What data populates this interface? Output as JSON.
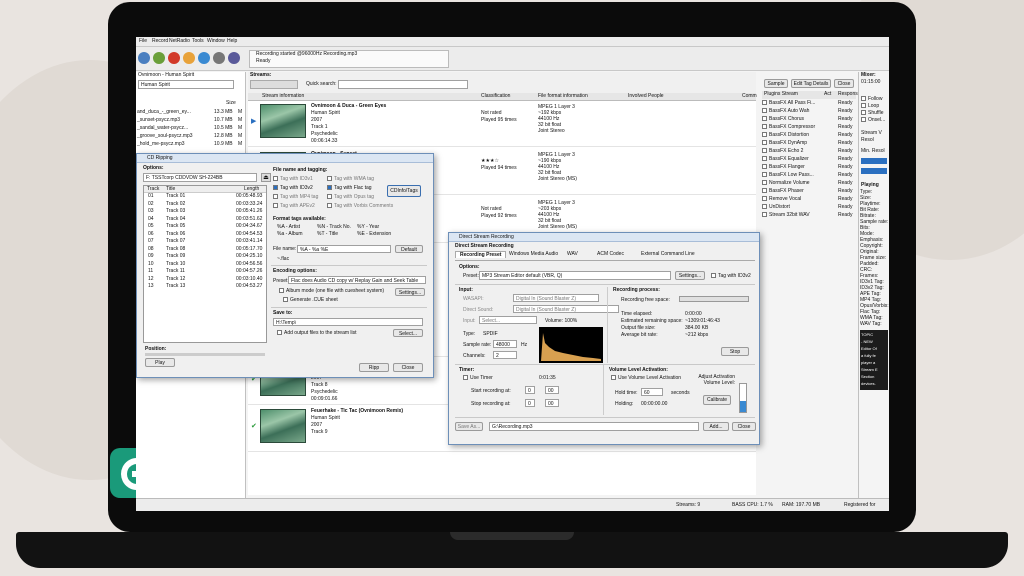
{
  "app": {
    "menu": [
      "File",
      "Record",
      "NetRadio",
      "Tools",
      "Window",
      "Help"
    ],
    "status": [
      "Recording started @96000Hz Recording.mp3",
      "Ready"
    ],
    "statusbar": {
      "streams": "Streams: 9",
      "cpu": "BASS CPU: 1.7 %",
      "ram": "RAM: 197.70 MB",
      "reg": "Registered for"
    }
  },
  "left": {
    "folder": "Ovnimoon - Human Spirit",
    "artist": "Human Spirit",
    "size_hdr": "Size",
    "files": [
      {
        "name": "and_duca_-_green_ey...",
        "size": "13.3 MB",
        "t": "M"
      },
      {
        "name": "_sunset-psycz.mp3",
        "size": "10.7 MB",
        "t": "M"
      },
      {
        "name": "_sandal_water-psycz...",
        "size": "10.5 MB",
        "t": "M"
      },
      {
        "name": "_groove_soul-psycz.mp3",
        "size": "12.8 MB",
        "t": "M"
      },
      {
        "name": "_hold_me-psycz.mp3",
        "size": "10.9 MB",
        "t": "M"
      }
    ]
  },
  "streams": {
    "label": "Streams:",
    "quick": "Quick search:",
    "cols": [
      "Stream information",
      "Classification",
      "File format information",
      "Involved People",
      "Comm"
    ],
    "items": [
      {
        "title": "Ovnimoon & Duca - Green Eyes",
        "lines": [
          "Human Spirit",
          "2007",
          "Track 1",
          "Psychedelic",
          "00:06:14.33"
        ],
        "cls": [
          "Not rated",
          "Played 95 times"
        ],
        "fmt": [
          "MPEG 1 Layer 3",
          "~192 kbps",
          "44100 Hz",
          "32 bit float",
          "Joint Stereo"
        ]
      },
      {
        "title": "Ovnimoon - Sunset",
        "lines": [],
        "cls": [
          "★★★☆",
          "Played 94 times"
        ],
        "fmt": [
          "MPEG 1 Layer 3",
          "~190 kbps",
          "44100 Hz",
          "32 bit float",
          "Joint Stereo (MS)"
        ]
      },
      {
        "title": "",
        "lines": [],
        "cls": [
          "Not rated",
          "Played 92 times"
        ],
        "fmt": [
          "MPEG 1 Layer 3",
          "~203 kbps",
          "44100 Hz",
          "32 bit float",
          "Joint Stereo (MS)"
        ]
      },
      {
        "title": "",
        "lines": [
          "Human Spirit",
          "2007",
          "Track 7",
          "Psychedelic",
          "00:08:01.18"
        ],
        "cls": [],
        "fmt": []
      },
      {
        "title": "Ovnimoon - Turn Off The light",
        "lines": [
          "Human Spirit",
          "2007",
          "Track 8",
          "Psychedelic",
          "00:09:01.66"
        ],
        "cls": [],
        "fmt": []
      },
      {
        "title": "Feuerhake - Tic Tac (Ovnimoon Remix)",
        "lines": [
          "Human Spirit",
          "2007",
          "Track 9"
        ],
        "cls": [
          "Not rated",
          "Played 90 times"
        ],
        "fmt": [
          "MPEG 1 Layer 3",
          "~200 kbps",
          "44100 Hz"
        ]
      }
    ]
  },
  "right": {
    "buttons": [
      "Sample",
      "Edit Tag Details",
      "Close"
    ],
    "plugin_hdr": [
      "Plugins Stream",
      "Act",
      "Response"
    ],
    "plugins": [
      "BassFX All Pass Fi...",
      "BassFX Auto Wah",
      "BassFX Chorus",
      "BassFX Compressor",
      "BassFX Distortion",
      "BassFX DynAmp",
      "BassFX Echo 2",
      "BassFX Equalizer",
      "BassFX Flanger",
      "BassFX Low Pass...",
      "Normalize Volume",
      "BassFX Phaser",
      "Remove Vocal",
      "UnDistort",
      "Stream 32bit WAV"
    ],
    "plugin_state": "Ready",
    "mixer": "Mixer:",
    "time": "01:15:00",
    "opts": [
      "Follow",
      "Loop",
      "Shuffle",
      "Onsel..."
    ],
    "stream_v": "Stream V",
    "res": "Resol",
    "minres": "Min. Resol",
    "playing": "Playing",
    "props": [
      "Type:",
      "Size:",
      "Playtime:",
      "Bit Rate:",
      "Bitrate:",
      "Sample rate:",
      "Bits:",
      "Mode:",
      "Emphasis:",
      "Copyright:",
      "Original:",
      "Frame size:",
      "Padded:",
      "CRC:",
      "Frames:",
      "ID3v1 Tag:",
      "ID3v2 Tag:",
      "APE Tag:",
      "MP4 Tag:",
      "Opus/Vorbis:",
      "Flac Tag:",
      "WMA Tag:",
      "WAV Tag:"
    ],
    "ad": [
      "TOPIC",
      "- NEW",
      "Editor Of",
      "a fully fe",
      "player a",
      "Stream E",
      "Section",
      "devices."
    ]
  },
  "cd": {
    "title": "CD Ripping",
    "options": "Options:",
    "drive": "F: TSSTcorp CDDVDW SH-224BB",
    "cols": [
      "Track",
      "Title",
      "Length"
    ],
    "tracks": [
      [
        "01",
        "Track 01",
        "00:05:48.93"
      ],
      [
        "02",
        "Track 02",
        "00:03:33.24"
      ],
      [
        "03",
        "Track 03",
        "00:05:41.26"
      ],
      [
        "04",
        "Track 04",
        "00:03:51.62"
      ],
      [
        "05",
        "Track 05",
        "00:04:34.67"
      ],
      [
        "06",
        "Track 06",
        "00:04:54.53"
      ],
      [
        "07",
        "Track 07",
        "00:03:41.14"
      ],
      [
        "08",
        "Track 08",
        "00:05:17.70"
      ],
      [
        "09",
        "Track 09",
        "00:04:25.10"
      ],
      [
        "10",
        "Track 10",
        "00:04:56.56"
      ],
      [
        "11",
        "Track 11",
        "00:04:57.26"
      ],
      [
        "12",
        "Track 12",
        "00:03:10.40"
      ],
      [
        "13",
        "Track 13",
        "00:04:53.27"
      ]
    ],
    "position": "Position:",
    "play": "Play",
    "tag_hdr": "File name and tagging:",
    "tags": [
      "Tag with ID3v1",
      "Tag with ID3v2",
      "Tag with MP4 tag",
      "Tag with APEv2",
      "Tag with WMA tag",
      "Tag with Flac tag",
      "Tag with Opus tag",
      "Tag with Vorbis Comments"
    ],
    "cdinfo": "CDInfo/Tags",
    "fmt_hdr": "Format tags available:",
    "fmt_tags": [
      "%A - Artist",
      "%a - Album",
      "%N - Track No.",
      "%T - Title",
      "%Y - Year",
      "%E - Extension"
    ],
    "fname_lbl": "File name:",
    "fname": "%A - %a %E",
    "flac": "~.flac",
    "default": "Default",
    "enc_hdr": "Encoding options:",
    "preset_lbl": "Preset:",
    "preset": "Flac does Audio CD copy w/ Replay Gain and Seek Table",
    "album": "Album mode (one file with cuesheet system)",
    "settings": "Settings...",
    "cue": "Generate .CUE sheet",
    "save_hdr": "Save to:",
    "save": "H:\\Temp\\",
    "add": "Add output files to the stream list",
    "select": "Select...",
    "rip": "Ripp",
    "close": "Close"
  },
  "dsr": {
    "title": "Direct Stream Recording",
    "hdr": "Direct Stream Recording",
    "tabs": [
      "Recording Preset",
      "Windows Media Audio",
      "WAV",
      "ACM Codec",
      "External Command Line"
    ],
    "options": "Options:",
    "preset_lbl": "Preset:",
    "preset": "MP3 Stream Editor default (VBR, Q)",
    "settings": "Settings...",
    "id3": "Tag with ID3v2",
    "input": "Input:",
    "wasapi": "WASAPI:",
    "direct": "Direct Sound:",
    "wasapi_v": "Digital In (Sound Blaster Z)",
    "direct_v": "Digital In (Sound Blaster Z)",
    "input_lbl": "Input:",
    "select": "Select...",
    "volume": "Volume: 100%",
    "type_lbl": "Type:",
    "type": "SPDIF",
    "srate_lbl": "Sample rate:",
    "srate": "48000",
    "hz": "Hz",
    "ch_lbl": "Channels:",
    "ch": "2",
    "proc": "Recording process:",
    "free": "Recording free space:",
    "elapsed_lbl": "Time elapsed:",
    "elapsed": "0:00:00",
    "remain_lbl": "Estimated remaining space:",
    "remain": "~1309:01:46:43",
    "size_lbl": "Output file size:",
    "size": "384.00 KB",
    "avg_lbl": "Average bit rate:",
    "avg": "~212 kbps",
    "stop": "Stop",
    "timer": "Timer:",
    "usetimer": "Use Timer",
    "timer_v": "0:01:35",
    "start_lbl": "Start recording at:",
    "stop_lbl": "Stop recording at:",
    "t0": "0",
    "t1": "00",
    "vla": "Volume Level Activation:",
    "usevla": "Use Volume Level Activation",
    "hold_lbl": "Hold time:",
    "hold": "60",
    "seconds": "seconds",
    "holding_lbl": "Holding:",
    "holding": "00:00:00.00",
    "adjust": "Adjust Activation Volume Level:",
    "calibrate": "Calibrate",
    "saveas": "Save As...",
    "path": "G:\\Recording.mp3",
    "add": "Add...",
    "close": "Close"
  }
}
